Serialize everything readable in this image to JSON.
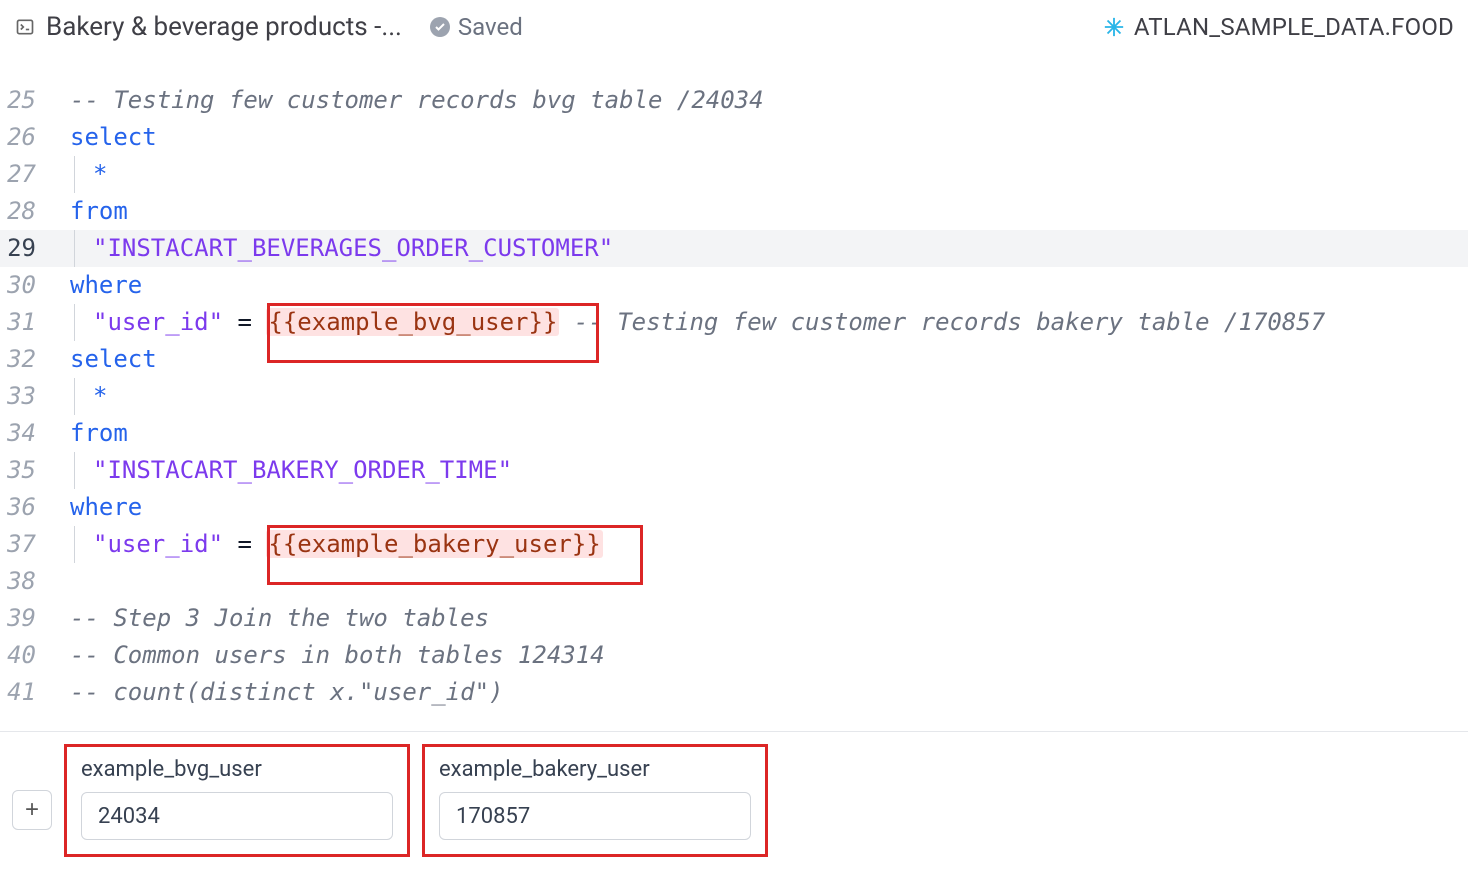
{
  "header": {
    "title": "Bakery & beverage products -...",
    "saved_label": "Saved",
    "database_label": "ATLAN_SAMPLE_DATA.FOOD"
  },
  "editor": {
    "highlight_line": 29,
    "lines": [
      {
        "n": 25,
        "tokens": [
          {
            "cls": "tok-cmt",
            "t": "-- Testing few customer records bvg table /24034"
          }
        ]
      },
      {
        "n": 26,
        "tokens": [
          {
            "cls": "tok-kw",
            "t": "select"
          }
        ]
      },
      {
        "n": 27,
        "indent": true,
        "tokens": [
          {
            "cls": "tok-star",
            "t": "*"
          }
        ]
      },
      {
        "n": 28,
        "tokens": [
          {
            "cls": "tok-kw",
            "t": "from"
          }
        ]
      },
      {
        "n": 29,
        "indent": true,
        "tokens": [
          {
            "cls": "tok-str",
            "t": "\"INSTACART_BEVERAGES_ORDER_CUSTOMER\""
          }
        ]
      },
      {
        "n": 30,
        "tokens": [
          {
            "cls": "tok-kw",
            "t": "where"
          }
        ]
      },
      {
        "n": 31,
        "indent": true,
        "tokens": [
          {
            "cls": "tok-str",
            "t": "\"user_id\""
          },
          {
            "cls": "",
            "t": " "
          },
          {
            "cls": "tok-op",
            "t": "="
          },
          {
            "cls": "",
            "t": " "
          },
          {
            "cls": "tok-mst",
            "t": "{{example_bvg_user}}"
          },
          {
            "cls": "",
            "t": " "
          },
          {
            "cls": "tok-cmt",
            "t": "-- Testing few customer records bakery table /170857"
          }
        ]
      },
      {
        "n": 32,
        "tokens": [
          {
            "cls": "tok-kw",
            "t": "select"
          }
        ]
      },
      {
        "n": 33,
        "indent": true,
        "tokens": [
          {
            "cls": "tok-star",
            "t": "*"
          }
        ]
      },
      {
        "n": 34,
        "tokens": [
          {
            "cls": "tok-kw",
            "t": "from"
          }
        ]
      },
      {
        "n": 35,
        "indent": true,
        "tokens": [
          {
            "cls": "tok-str",
            "t": "\"INSTACART_BAKERY_ORDER_TIME\""
          }
        ]
      },
      {
        "n": 36,
        "tokens": [
          {
            "cls": "tok-kw",
            "t": "where"
          }
        ]
      },
      {
        "n": 37,
        "indent": true,
        "tokens": [
          {
            "cls": "tok-str",
            "t": "\"user_id\""
          },
          {
            "cls": "",
            "t": " "
          },
          {
            "cls": "tok-op",
            "t": "="
          },
          {
            "cls": "",
            "t": " "
          },
          {
            "cls": "tok-mst",
            "t": "{{example_bakery_user}}"
          }
        ]
      },
      {
        "n": 38,
        "indent": true,
        "tokens": [
          {
            "cls": "",
            "t": ""
          }
        ]
      },
      {
        "n": 39,
        "tokens": [
          {
            "cls": "tok-cmt",
            "t": "-- Step 3 Join the two tables"
          }
        ]
      },
      {
        "n": 40,
        "tokens": [
          {
            "cls": "tok-cmt",
            "t": "-- Common users in both tables 124314"
          }
        ]
      },
      {
        "n": 41,
        "tokens": [
          {
            "cls": "tok-cmt",
            "t": "-- count(distinct x.\"user_id\")"
          }
        ]
      }
    ]
  },
  "parameters": [
    {
      "name": "example_bvg_user",
      "value": "24034"
    },
    {
      "name": "example_bakery_user",
      "value": "170857"
    }
  ],
  "add_button_label": "+"
}
